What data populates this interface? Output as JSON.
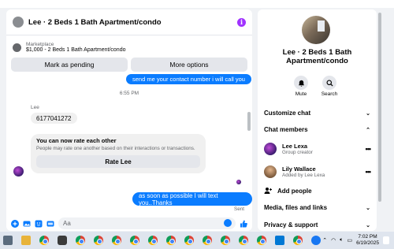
{
  "chat": {
    "title": "Lee · 2 Beds 1 Bath Apartment/condo",
    "listing_category": "Marketplace",
    "listing_desc": "$1,000 - 2 Beds 1 Bath Apartment/condo",
    "btn_pending": "Mark as pending",
    "btn_more": "More options",
    "msg_out_1": "send me your contact number i will call you",
    "time_1": "6:55 PM",
    "sender": "Lee",
    "msg_in_1": "6177041272",
    "card_title": "You can now rate each other",
    "card_sub": "People may rate one another based on their interactions or transactions.",
    "card_btn": "Rate Lee",
    "msg_out_2": "as soon as possible I will text you..Thanks",
    "sent": "Sent",
    "input_placeholder": "Aa"
  },
  "side": {
    "title": "Lee · 2 Beds 1 Bath Apartment/condo",
    "actions": [
      {
        "label": "Mute"
      },
      {
        "label": "Search"
      }
    ],
    "customize": "Customize chat",
    "members_header": "Chat members",
    "members": [
      {
        "name": "Lee Lexa",
        "sub": "Group creator"
      },
      {
        "name": "Lily Wallace",
        "sub": "Added by Lee Lexa"
      }
    ],
    "add_people": "Add people",
    "media": "Media, files and links",
    "privacy": "Privacy & support"
  },
  "taskbar": {
    "time": "7:02 PM",
    "date": "6/19/2025"
  },
  "colors": {
    "accent": "#0a7cff",
    "info": "#a033ff"
  }
}
